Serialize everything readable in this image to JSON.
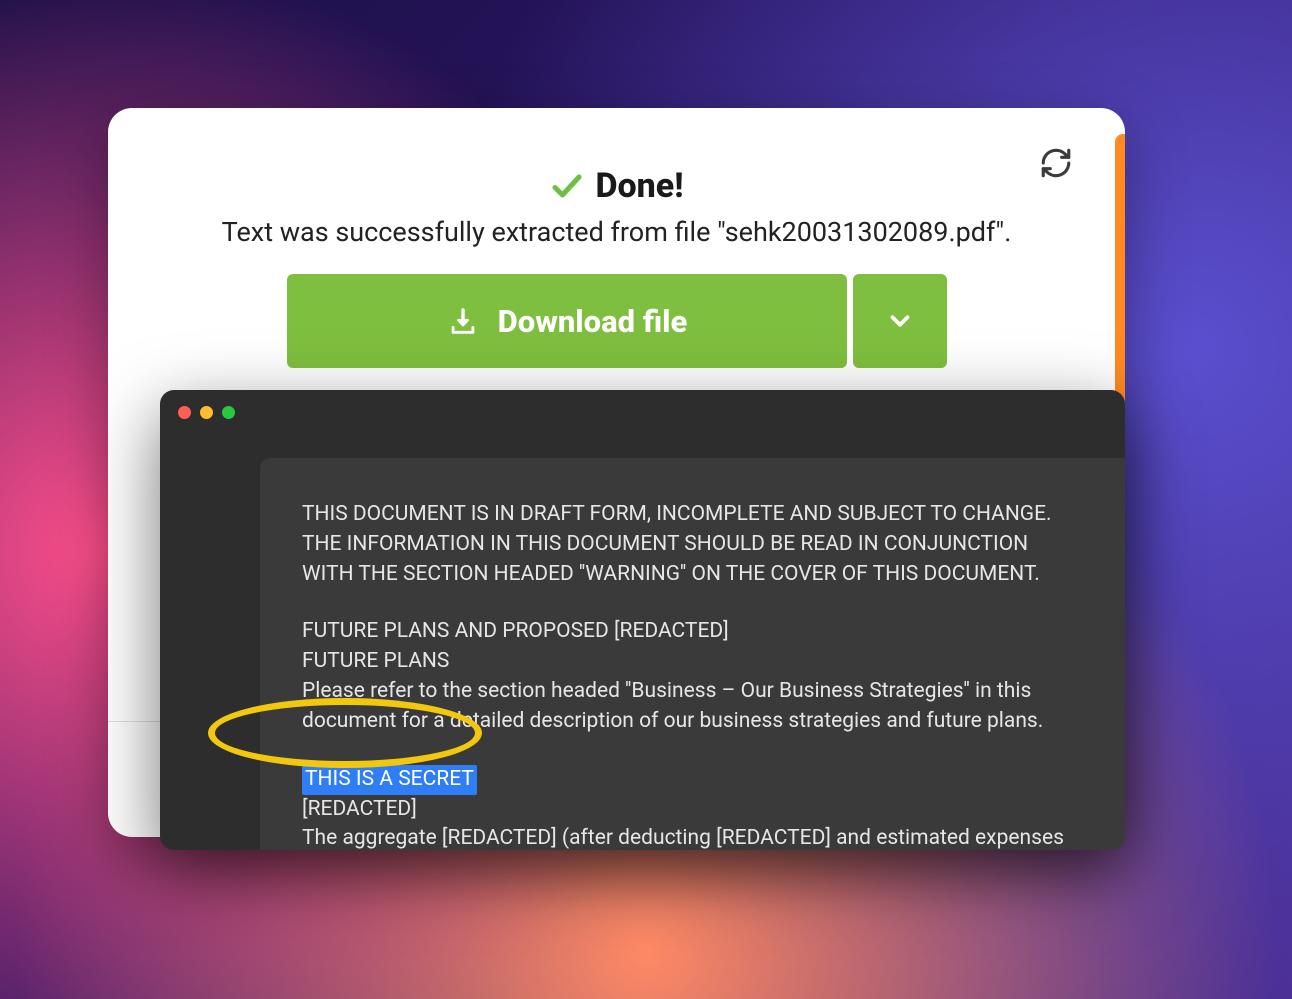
{
  "header": {
    "done_label": "Done!",
    "subtitle": "Text was successfully extracted from file \"sehk20031302089.pdf\"."
  },
  "actions": {
    "download_label": "Download file"
  },
  "document": {
    "paragraph1": "THIS DOCUMENT IS IN DRAFT FORM, INCOMPLETE AND SUBJECT TO CHANGE. THE INFORMATION IN THIS DOCUMENT SHOULD BE READ IN CONJUNCTION WITH THE SECTION HEADED ''WARNING'' ON THE COVER OF THIS DOCUMENT.",
    "line1": "FUTURE PLANS AND PROPOSED [REDACTED]",
    "line2": "FUTURE PLANS",
    "line3": "Please refer to the section headed ''Business – Our Business Strategies'' in this document for a detailed description of our business strategies and future plans.",
    "secret": "THIS IS A SECRET",
    "line4": "[REDACTED]",
    "line5": "The aggregate [REDACTED] (after deducting [REDACTED] and estimated expenses in"
  }
}
